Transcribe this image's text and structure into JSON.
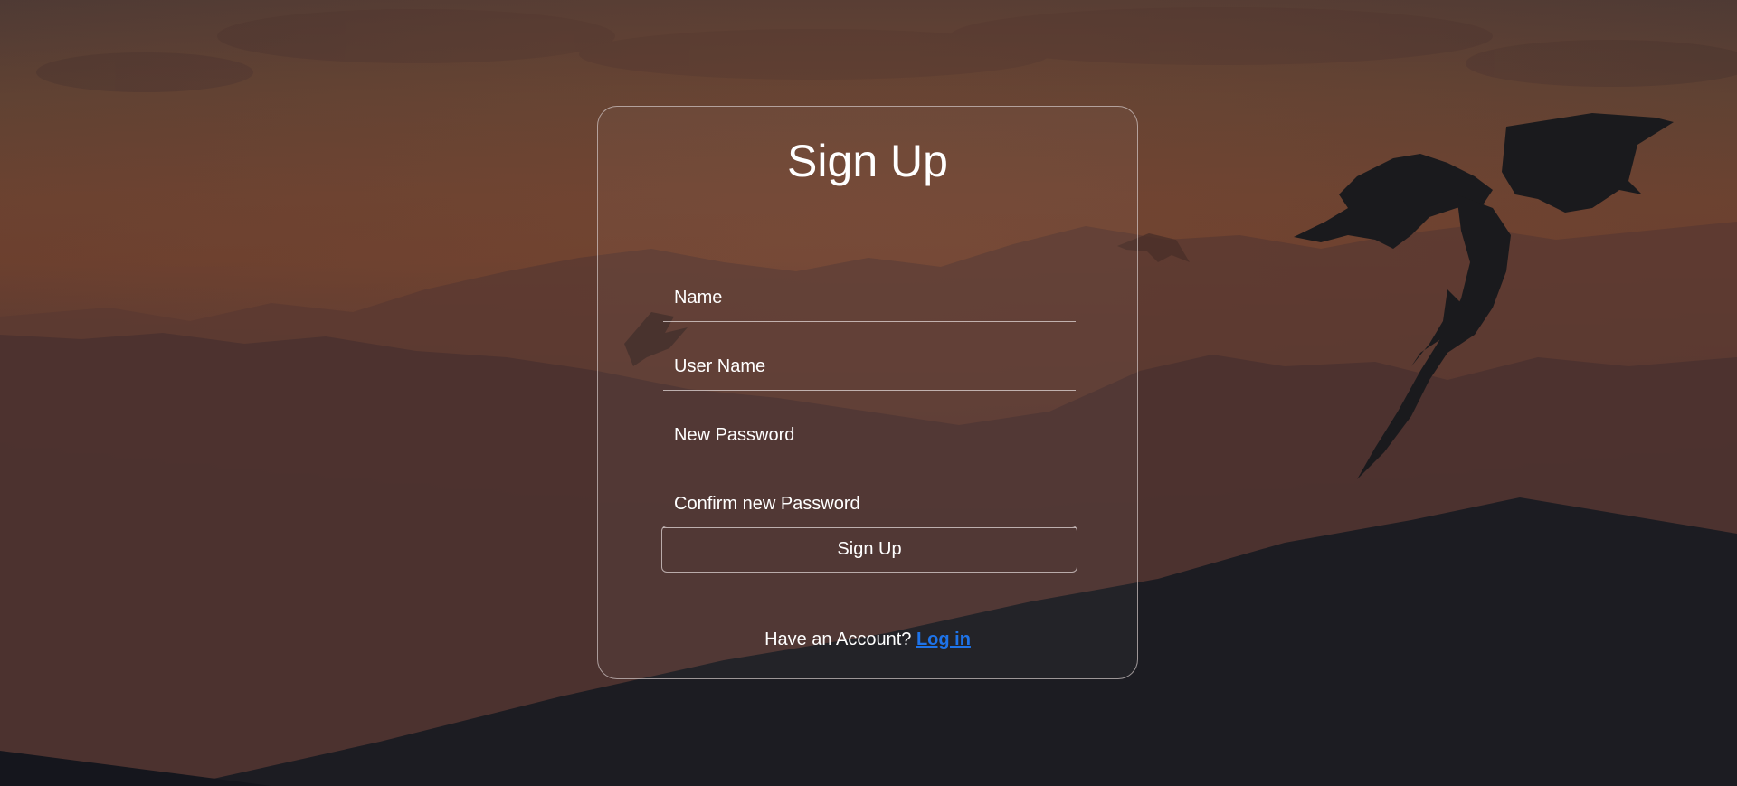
{
  "background": {
    "scene_icon": "dragon-mountains-sunset"
  },
  "form": {
    "title": "Sign Up",
    "fields": [
      {
        "placeholder": "Name",
        "value": ""
      },
      {
        "placeholder": "User Name",
        "value": ""
      },
      {
        "placeholder": "New Password",
        "value": ""
      },
      {
        "placeholder": "Confirm new Password",
        "value": ""
      }
    ],
    "submit_label": "Sign Up",
    "footer_text": "Have an Account? ",
    "login_link": "Log in"
  },
  "colors": {
    "link": "#1e73e8",
    "card_border": "#d2c8c8",
    "text": "#ffffff"
  }
}
